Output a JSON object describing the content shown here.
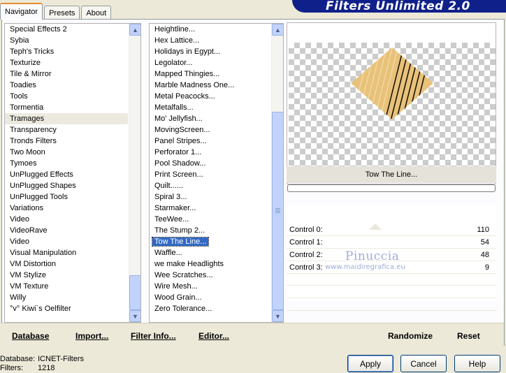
{
  "tabs": [
    "Navigator",
    "Presets",
    "About"
  ],
  "banner_title": "Filters Unlimited 2.0",
  "categories": [
    "Special Effects 2",
    "Sybia",
    "Teph's Tricks",
    "Texturize",
    "Tile & Mirror",
    "Toadies",
    "Tools",
    "Tormentia",
    "Tramages",
    "Transparency",
    "Tronds Filters",
    "Two Moon",
    "Tymoes",
    "UnPlugged Effects",
    "UnPlugged Shapes",
    "UnPlugged Tools",
    "Variations",
    "Video",
    "VideoRave",
    "Video",
    "Visual Manipulation",
    "VM Distortion",
    "VM Stylize",
    "VM Texture",
    "Willy",
    "°v° Kiwi`s Oelfilter"
  ],
  "selected_category": "Tramages",
  "filters": [
    "Heightline...",
    "Hex Lattice...",
    "Holidays in Egypt...",
    "Legolator...",
    "Mapped Thingies...",
    "Marble Madness One...",
    "Metal Peacocks...",
    "Metalfalls...",
    "Mo' Jellyfish...",
    "MovingScreen...",
    "Panel Stripes...",
    "Perforator 1...",
    "Pool Shadow...",
    "Print Screen...",
    "Quilt......",
    "Spiral 3...",
    "Starmaker...",
    "TeeWee...",
    "The Stump 2...",
    "Tow The Line...",
    "Waffle...",
    "we make Headlights",
    "Wee Scratches...",
    "Wire Mesh...",
    "Wood Grain...",
    "Zero Tolerance..."
  ],
  "selected_filter": "Tow The Line...",
  "preview": {
    "filter_name": "Tow The Line...",
    "shape_color": "#e8c27a",
    "stripe_color": "#1a1208"
  },
  "controls": [
    {
      "label": "Control 0:",
      "value": "110"
    },
    {
      "label": "Control 1:",
      "value": "54"
    },
    {
      "label": "Control 2:",
      "value": "48"
    },
    {
      "label": "Control 3:",
      "value": "9"
    }
  ],
  "watermark": {
    "line1": "Pinuccia",
    "line2": "www.maidiregrafica.eu"
  },
  "bottom_links": {
    "database": "Database",
    "import": "Import...",
    "filter_info": "Filter Info...",
    "editor": "Editor...",
    "randomize": "Randomize",
    "reset": "Reset"
  },
  "status": {
    "database_label": "Database:",
    "database_value": "ICNET-Filters",
    "filters_label": "Filters:",
    "filters_value": "1218"
  },
  "buttons": {
    "apply": "Apply",
    "cancel": "Cancel",
    "help": "Help"
  }
}
